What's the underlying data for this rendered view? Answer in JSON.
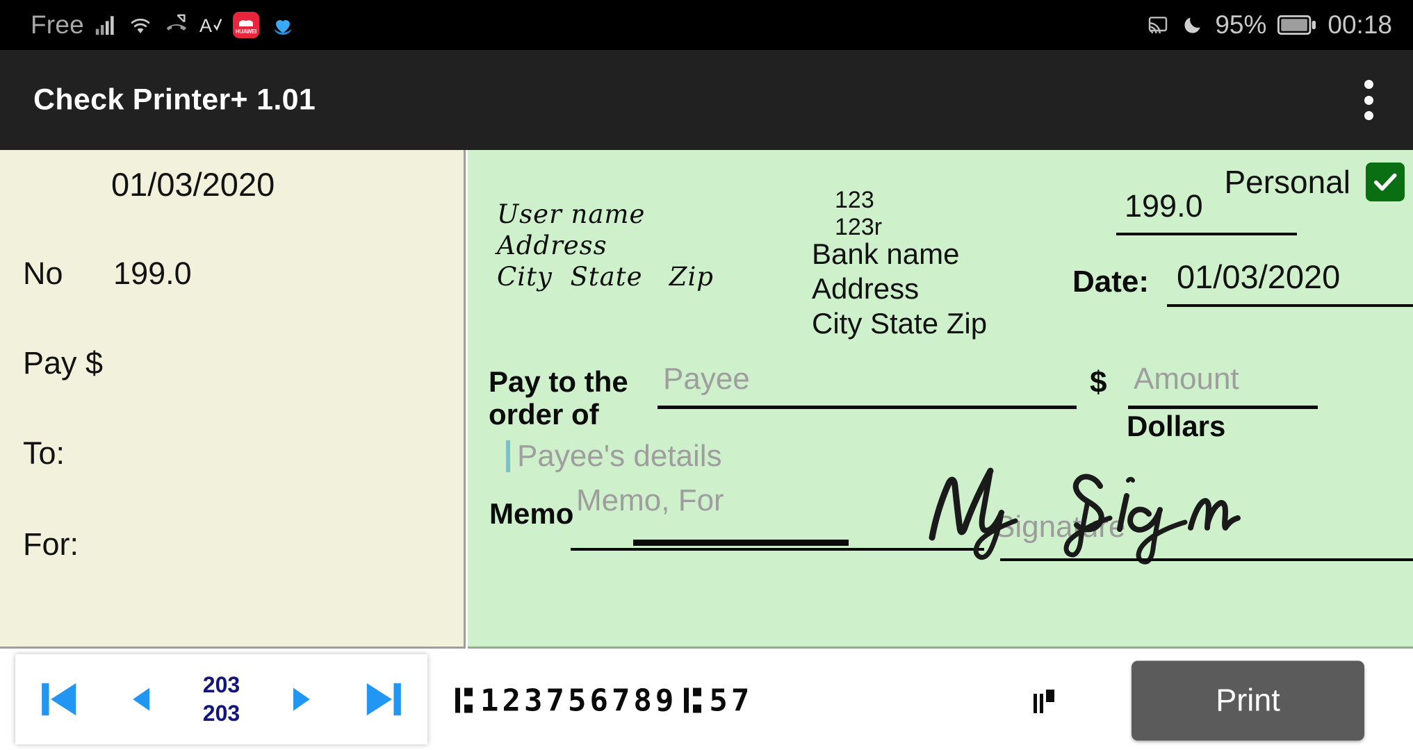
{
  "statusbar": {
    "carrier": "Free",
    "icons": [
      "signal-bars-icon",
      "wifi-icon",
      "missed-call-icon",
      "font-size-icon",
      "huawei-icon",
      "health-app-icon"
    ],
    "huawei_label": "HUAWEI",
    "cast_icon": "cast-icon",
    "dnd_icon": "moon-icon",
    "battery_percent": "95%",
    "battery_icon": "battery-icon",
    "clock": "00:18"
  },
  "appbar": {
    "title": "Check Printer+ 1.01",
    "overflow_icon": "more-vertical-icon"
  },
  "preview": {
    "date": "01/03/2020",
    "rows": [
      {
        "label": "No",
        "value": "199.0"
      },
      {
        "label": "Pay $",
        "value": ""
      },
      {
        "label": "To:",
        "value": ""
      },
      {
        "label": "For:",
        "value": ""
      }
    ]
  },
  "check": {
    "personal_label": "Personal",
    "personal_checked": true,
    "check_accent": "#0a6e12",
    "paper_color": "#cef0cb",
    "payer": {
      "name": "User name",
      "address": "Address",
      "city_state_zip": "City  State   Zip"
    },
    "check_number": {
      "line1": "123",
      "line2": "123r"
    },
    "bank": {
      "name": "Bank name",
      "address": "Address",
      "city_state_zip": "City State Zip"
    },
    "amount_top": "199.0",
    "date_label": "Date:",
    "date_value": "01/03/2020",
    "pay_to_label": "Pay to the order of",
    "payee_placeholder": "Payee",
    "dollar_symbol": "$",
    "amount_placeholder": "Amount",
    "dollars_label": "Dollars",
    "payee_details_placeholder": "Payee's details",
    "memo_label": "Memo",
    "memo_placeholder": "Memo, For",
    "signature_placeholder": "Signature",
    "signature_text": "My Sign"
  },
  "bottombar": {
    "first_icon": "skip-to-first-icon",
    "prev_icon": "previous-icon",
    "next_icon": "next-icon",
    "last_icon": "skip-to-last-icon",
    "page_current": "203",
    "page_total": "203",
    "micr_routing": "123756789",
    "micr_account": "57",
    "micr_symbol": "transit-symbol",
    "onus_symbol": "on-us-symbol",
    "print_label": "Print"
  }
}
